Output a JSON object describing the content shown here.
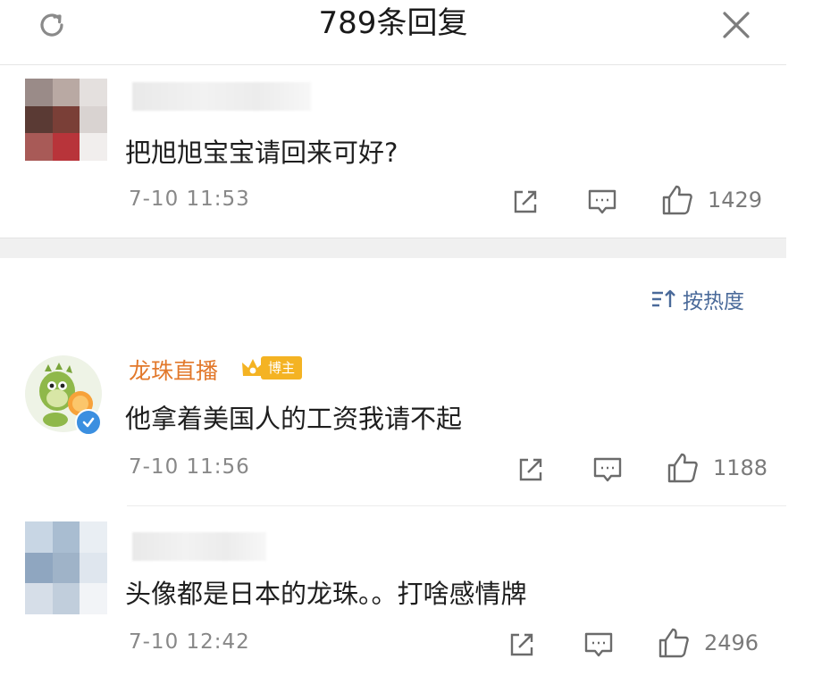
{
  "header": {
    "title": "789条回复",
    "refresh_icon": "refresh-icon",
    "close_icon": "close-icon"
  },
  "sort": {
    "label": "按热度",
    "icon": "sort-icon"
  },
  "comments": [
    {
      "author": "",
      "author_obscured": true,
      "text": "把旭旭宝宝请回来可好?",
      "time": "7-10 11:53",
      "likes": "1429"
    },
    {
      "author": "龙珠直播",
      "badge": "博主",
      "verified": true,
      "text": "他拿着美国人的工资我请不起",
      "time": "7-10 11:56",
      "likes": "1188"
    },
    {
      "author": "",
      "author_obscured": true,
      "text": "头像都是日本的龙珠。。打啥感情牌",
      "time": "7-10 12:42",
      "likes": "2496"
    }
  ],
  "colors": {
    "author_name": "#e2782b",
    "badge_bg": "#f4b323",
    "sort_text": "#4a6a9a",
    "icon_stroke": "#6b6b6b",
    "verified": "#3b8fe0"
  }
}
